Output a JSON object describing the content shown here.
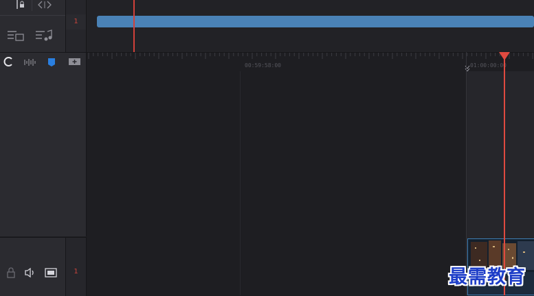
{
  "timeline": {
    "ruler_timecodes": [
      "00:59:58:00",
      "01:00:00:00"
    ],
    "track_index_top": "1",
    "track_index_bottom": "1",
    "clip_color": "#4a82b6",
    "playhead_color": "#e04a40"
  },
  "toolbar": {
    "icons": [
      "snap-icon",
      "audio-waveform-icon",
      "marker-flag-icon",
      "add-track-icon"
    ]
  },
  "track_header": {
    "icons": [
      "lock-icon",
      "speaker-icon",
      "film-icon"
    ]
  },
  "watermark": {
    "text": "最需教育"
  }
}
